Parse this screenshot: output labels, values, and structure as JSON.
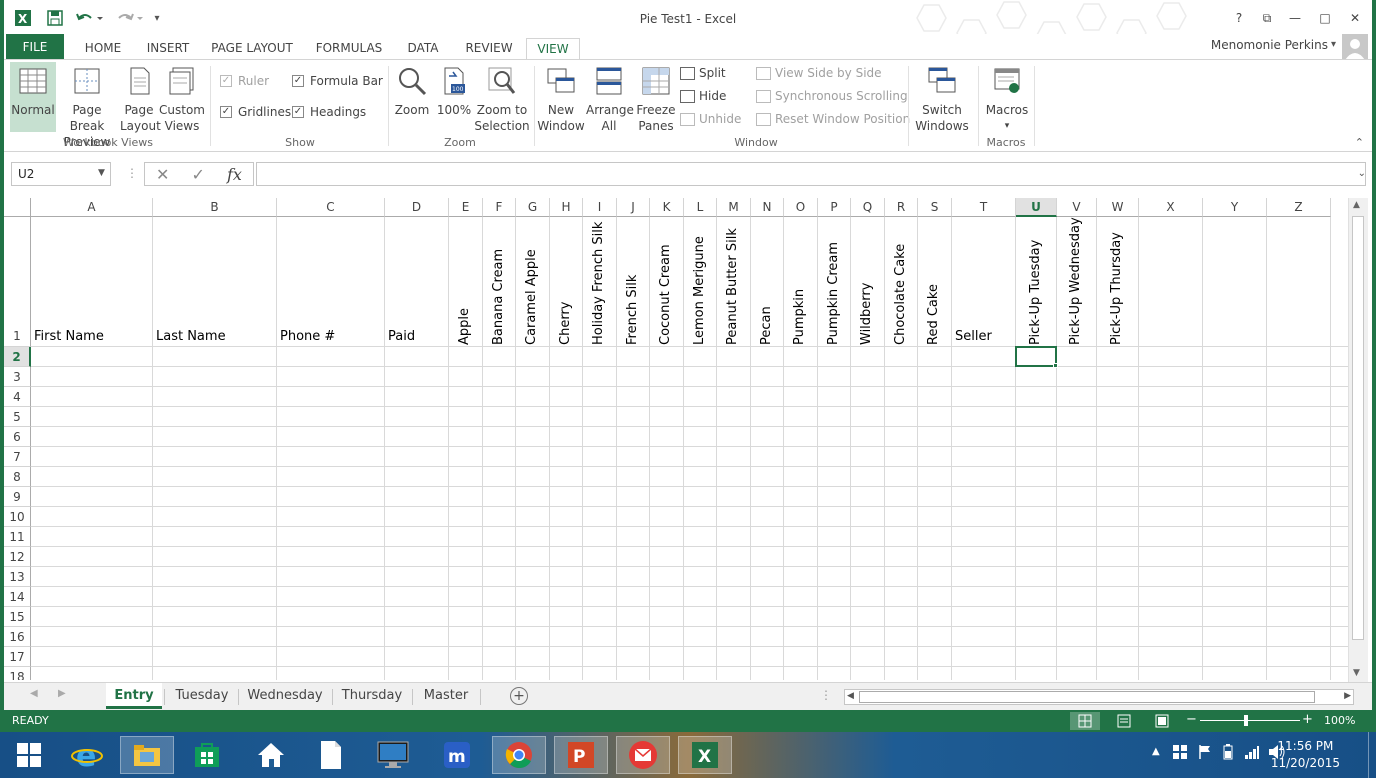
{
  "window": {
    "title": "Pie Test1 - Excel"
  },
  "ribbon_tabs": [
    "FILE",
    "HOME",
    "INSERT",
    "PAGE LAYOUT",
    "FORMULAS",
    "DATA",
    "REVIEW",
    "VIEW"
  ],
  "user_name": "Menomonie Perkins",
  "ribbon": {
    "workbook_views": {
      "normal": "Normal",
      "page_break_1": "Page Break",
      "page_break_2": "Preview",
      "page_layout_1": "Page",
      "page_layout_2": "Layout",
      "custom_views_1": "Custom",
      "custom_views_2": "Views",
      "label": "Workbook Views"
    },
    "show": {
      "ruler": "Ruler",
      "formula_bar": "Formula Bar",
      "gridlines": "Gridlines",
      "headings": "Headings",
      "label": "Show"
    },
    "zoom": {
      "zoom": "Zoom",
      "hundred": "100%",
      "zoom_sel_1": "Zoom to",
      "zoom_sel_2": "Selection",
      "label": "Zoom"
    },
    "window": {
      "new_1": "New",
      "new_2": "Window",
      "arrange_1": "Arrange",
      "arrange_2": "All",
      "freeze_1": "Freeze",
      "freeze_2": "Panes",
      "split": "Split",
      "hide": "Hide",
      "unhide": "Unhide",
      "side_by_side": "View Side by Side",
      "sync_scroll": "Synchronous Scrolling",
      "reset_pos": "Reset Window Position",
      "switch_1": "Switch",
      "switch_2": "Windows",
      "label": "Window"
    },
    "macros": {
      "macros": "Macros",
      "label": "Macros"
    }
  },
  "formula_bar": {
    "name_box": "U2",
    "fx": "fx",
    "value": ""
  },
  "grid": {
    "columns": [
      "A",
      "B",
      "C",
      "D",
      "E",
      "F",
      "G",
      "H",
      "I",
      "J",
      "K",
      "L",
      "M",
      "N",
      "O",
      "P",
      "Q",
      "R",
      "S",
      "T",
      "U",
      "V",
      "W",
      "X",
      "Y",
      "Z"
    ],
    "rows": [
      "1",
      "2",
      "3",
      "4",
      "5",
      "6",
      "7",
      "8",
      "9",
      "10",
      "11",
      "12",
      "13",
      "14",
      "15",
      "16",
      "17",
      "18"
    ],
    "headers_horizontal": {
      "A": "First Name",
      "B": "Last Name",
      "C": "Phone #",
      "D": "Paid",
      "T": "Seller"
    },
    "headers_vertical": {
      "E": "Apple",
      "F": "Banana Cream",
      "G": "Caramel Apple",
      "H": "Cherry",
      "I": "Holiday French Silk",
      "J": "French Silk",
      "K": "Coconut Cream",
      "L": "Lemon Merigune",
      "M": "Peanut Butter Silk",
      "N": "Pecan",
      "O": "Pumpkin",
      "P": "Pumpkin Cream",
      "Q": "Wildberry",
      "R": "Chocolate Cake",
      "S": "Red Cake",
      "U": "Pick-Up Tuesday",
      "V": "Pick-Up Wednesday",
      "W": "Pick-Up Thursday"
    },
    "selected_cell": "U2"
  },
  "sheets": [
    "Entry",
    "Tuesday",
    "Wednesday",
    "Thursday",
    "Master"
  ],
  "active_sheet": "Entry",
  "status": {
    "mode": "READY",
    "zoom": "100%"
  },
  "taskbar": {
    "time": "11:56 PM",
    "date": "11/20/2015"
  },
  "colors": {
    "accent": "#217346",
    "taskbar": "#1e5c94"
  }
}
